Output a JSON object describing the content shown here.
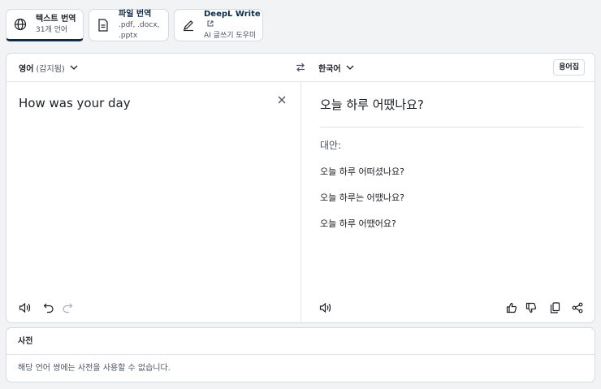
{
  "tabs": [
    {
      "title": "텍스트 번역",
      "subtitle": "31개 언어",
      "icon": "globe-icon"
    },
    {
      "title": "파일 번역",
      "subtitle": ".pdf, .docx, .pptx",
      "icon": "file-icon"
    },
    {
      "title": "DeepL Write",
      "subtitle": "AI 글쓰기 도우미",
      "icon": "pen-icon"
    }
  ],
  "translator": {
    "source_lang": "영어",
    "source_detect": "(감지됨)",
    "target_lang": "한국어",
    "glossary_label": "용어집",
    "source_text": "How was your day",
    "target_text": "오늘 하루 어땠나요?",
    "alternatives_label": "대안:",
    "alternatives": [
      "오늘 하루 어떠셨나요?",
      "오늘 하루는 어땠나요?",
      "오늘 하루 어땠어요?"
    ]
  },
  "dictionary": {
    "title": "사전",
    "message": "해당 언어 쌍에는 사전을 사용할 수 없습니다."
  },
  "colors": {
    "accent": "#0f2b46",
    "border": "#d6dbe1",
    "background": "#f1f3f5"
  }
}
